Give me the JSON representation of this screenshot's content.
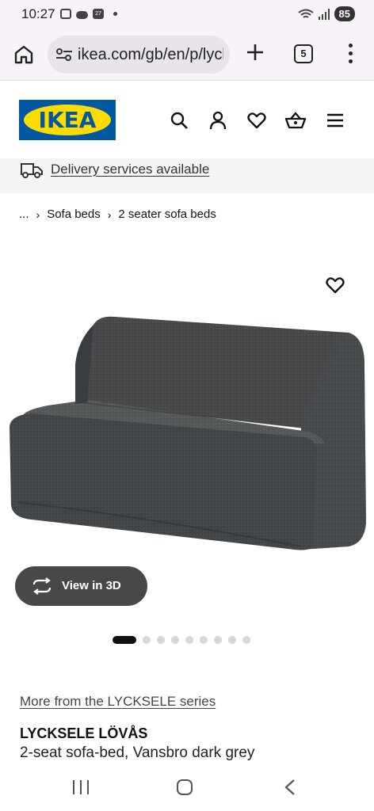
{
  "status_bar": {
    "time": "10:27",
    "calendar_day": "27",
    "battery": "85"
  },
  "browser": {
    "url": "ikea.com/gb/en/p/lycksele",
    "tab_count": "5"
  },
  "header": {
    "logo_text": "IKEA",
    "icons": [
      "search-icon",
      "account-icon",
      "heart-icon",
      "basket-icon",
      "hamburger-menu-icon"
    ]
  },
  "delivery": {
    "text": "Delivery services available"
  },
  "breadcrumb": {
    "ellipsis": "...",
    "items": [
      "Sofa beds",
      "2 seater sofa beds"
    ]
  },
  "product": {
    "view_3d_label": "View in 3D",
    "image_count": 9,
    "active_image_index": 0,
    "series_link": "More from the LYCKSELE series",
    "name": "LYCKSELE LÖVÅS",
    "description": "2-seat sofa-bed, Vansbro dark grey"
  },
  "colors": {
    "ikea_blue": "#0058a3",
    "ikea_yellow": "#ffdb00",
    "sofa_grey": "#4a4d4e"
  }
}
